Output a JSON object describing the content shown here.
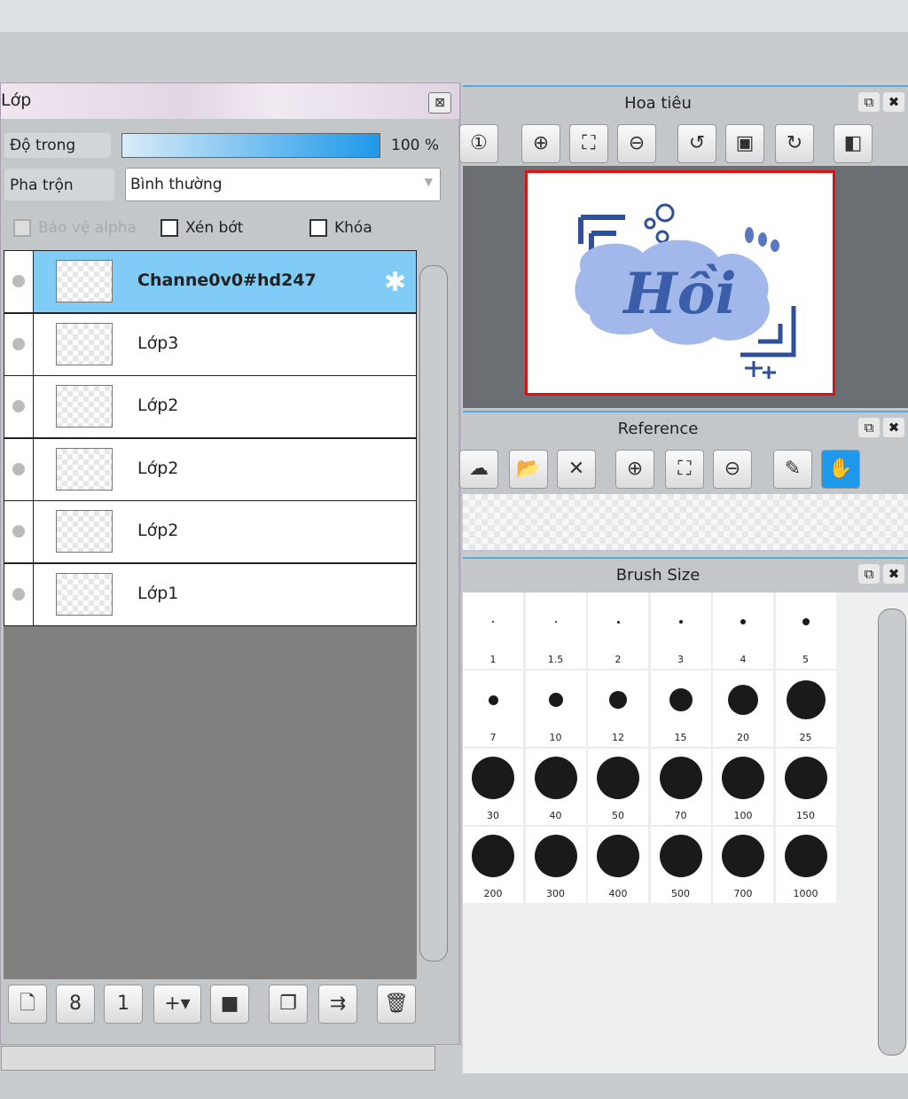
{
  "layer_panel": {
    "title": "Lớp",
    "close": "⊠",
    "opacity_label": "Độ trong",
    "opacity_value": "100 %",
    "opacity_percent": 100,
    "blend_label": "Pha trộn",
    "blend_value": "Bình thường",
    "protect_alpha": "Bảo vệ alpha",
    "clip": "Xén bớt",
    "lock": "Khóa",
    "layers": [
      {
        "name": "Channe0v0#hd247",
        "selected": true
      },
      {
        "name": "Lớp3"
      },
      {
        "name": "Lớp2"
      },
      {
        "name": "Lớp2"
      },
      {
        "name": "Lớp2"
      },
      {
        "name": "Lớp1"
      }
    ],
    "toolbar": [
      "new-layer-icon",
      "new-8bit-layer-icon",
      "new-1bit-layer-icon",
      "add-layer-menu-icon",
      "folder-icon",
      "duplicate-icon",
      "merge-down-icon",
      "trash-icon"
    ]
  },
  "navigator": {
    "title": "Hoa tiêu",
    "canvas_text": "Hồi",
    "accent": "#e01010"
  },
  "reference": {
    "title": "Reference",
    "active_tool": "hand",
    "active_color": "#1e98ea"
  },
  "brush_size": {
    "title": "Brush Size",
    "sizes": [
      "1",
      "1.5",
      "2",
      "3",
      "4",
      "5",
      "7",
      "10",
      "12",
      "15",
      "20",
      "25",
      "30",
      "40",
      "50",
      "70",
      "100",
      "150",
      "200",
      "300",
      "400",
      "500",
      "700",
      "1000"
    ]
  }
}
